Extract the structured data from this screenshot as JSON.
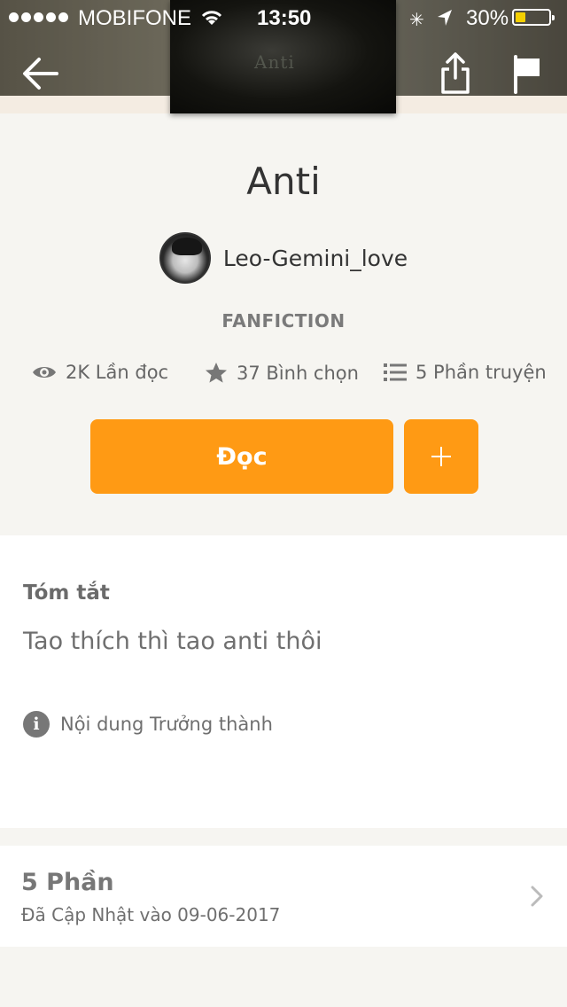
{
  "status_bar": {
    "carrier": "MOBIFONE",
    "time": "13:50",
    "battery_percent": "30%",
    "battery_level": 0.3,
    "signal_bars": 5
  },
  "header": {
    "cover_text": "Anti",
    "back_icon": "arrow-left-icon",
    "share_icon": "share-icon",
    "flag_icon": "flag-icon"
  },
  "story": {
    "title": "Anti",
    "author": "Leo-Gemini_love",
    "category": "FANFICTION",
    "stats": {
      "reads": "2K Lần đọc",
      "votes": "37 Bình chọn",
      "parts": "5 Phần truyện"
    }
  },
  "actions": {
    "read_label": "Đọc",
    "add_icon": "plus-icon"
  },
  "summary": {
    "heading": "Tóm tắt",
    "text": "Tao thích thì tao anti thôi",
    "mature_label": "Nội dung Trưởng thành"
  },
  "parts_section": {
    "count_label": "5 Phần",
    "updated_label": "Đã Cập Nhật vào 09-06-2017"
  },
  "colors": {
    "accent": "#ff9a14",
    "background": "#f6f5f1"
  }
}
